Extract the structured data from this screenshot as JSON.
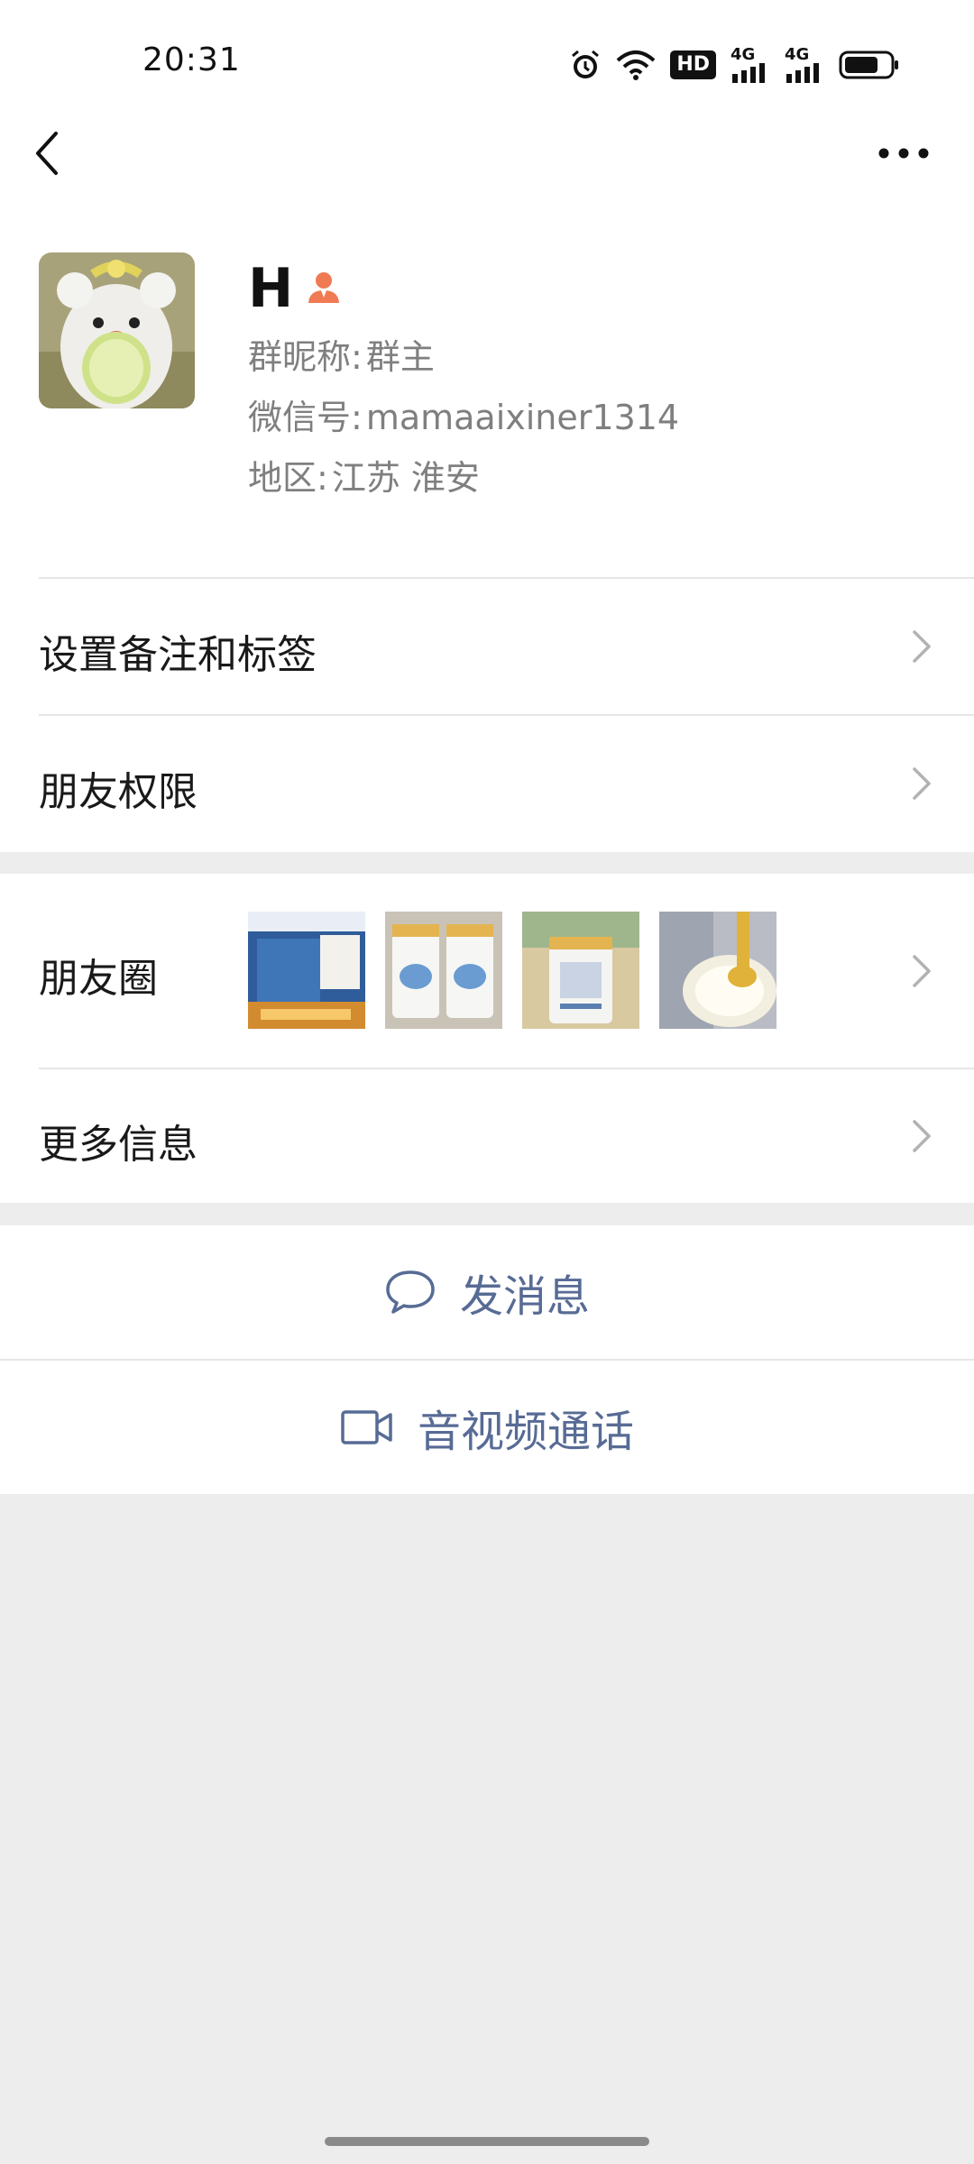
{
  "status_bar": {
    "time": "20:31",
    "hd_label": "HD",
    "net1": "4G",
    "net2": "4G",
    "icons": [
      "alarm-icon",
      "wifi-icon",
      "hd-icon",
      "signal-icon",
      "signal-icon",
      "battery-icon"
    ]
  },
  "nav": {
    "back_icon": "chevron-left-icon",
    "more_icon": "more-dots-icon"
  },
  "profile": {
    "name": "H",
    "badge_icon": "owner-person-icon",
    "group_nickname_label": "群昵称:",
    "group_nickname": "群主",
    "wechat_id_label": "微信号:",
    "wechat_id": "mamaaixiner1314",
    "region_label": "地区:",
    "region": "江苏 淮安"
  },
  "menu": {
    "remark_tags": "设置备注和标签",
    "friend_permissions": "朋友权限",
    "moments": "朋友圈",
    "more_info": "更多信息"
  },
  "actions": {
    "send_message": "发消息",
    "av_call": "音视频通话"
  },
  "colors": {
    "link": "#576b95",
    "badge": "#f07a52",
    "bg": "#ededed"
  }
}
